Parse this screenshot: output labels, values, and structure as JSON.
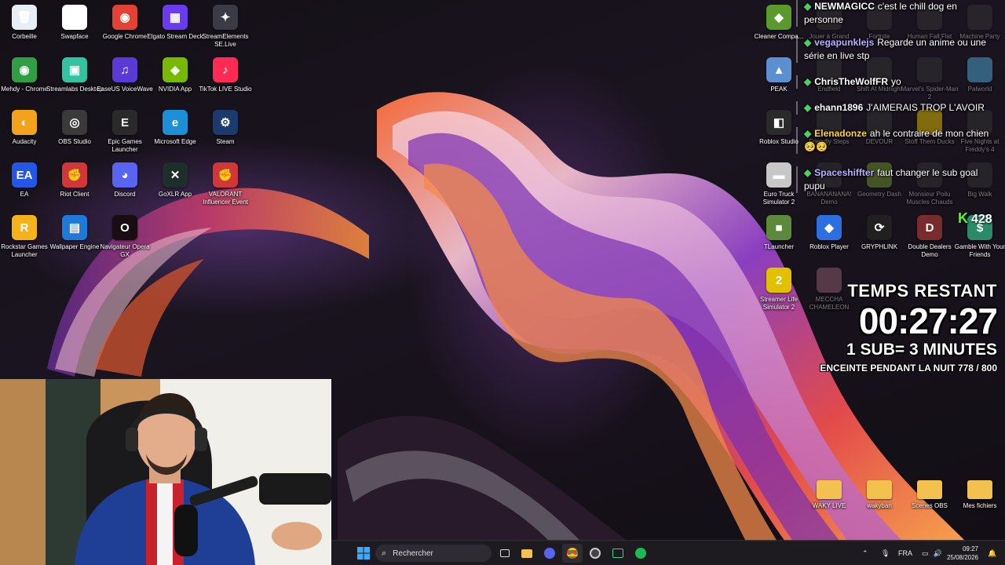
{
  "desktop_left": {
    "icons": [
      {
        "label": "Corbeille",
        "icon": "recycle-bin-icon",
        "glyph": "🗑",
        "color": "#e7eef5"
      },
      {
        "label": "Swapface",
        "icon": "mask-icon",
        "glyph": "◼",
        "color": "#ffffff"
      },
      {
        "label": "Google Chrome",
        "icon": "chrome-icon",
        "glyph": "◉",
        "color": "#e34133"
      },
      {
        "label": "Elgato Stream Deck",
        "icon": "stream-deck-icon",
        "glyph": "▦",
        "color": "#6a3cf0"
      },
      {
        "label": "StreamElements SE.Live",
        "icon": "se-live-icon",
        "glyph": "✦",
        "color": "#3b3b48"
      },
      {
        "label": "Mehdy - Chrome",
        "icon": "chrome-profile-icon",
        "glyph": "◉",
        "color": "#2f9e44"
      },
      {
        "label": "Streamlabs Desktop",
        "icon": "streamlabs-icon",
        "glyph": "▣",
        "color": "#31c3a2"
      },
      {
        "label": "EaseUS VoiceWave",
        "icon": "voicewave-icon",
        "glyph": "♫",
        "color": "#5a3ad6"
      },
      {
        "label": "NVIDIA App",
        "icon": "nvidia-icon",
        "glyph": "◈",
        "color": "#76b900"
      },
      {
        "label": "TikTok LIVE Studio",
        "icon": "tiktok-icon",
        "glyph": "♪",
        "color": "#fe2c55"
      },
      {
        "label": "Audacity",
        "icon": "audacity-icon",
        "glyph": "◐",
        "color": "#f2a21b"
      },
      {
        "label": "OBS Studio",
        "icon": "obs-icon",
        "glyph": "◎",
        "color": "#3a3a3a"
      },
      {
        "label": "Epic Games Launcher",
        "icon": "epic-games-icon",
        "glyph": "E",
        "color": "#2a2a2a"
      },
      {
        "label": "Microsoft Edge",
        "icon": "edge-icon",
        "glyph": "e",
        "color": "#1d8fd6"
      },
      {
        "label": "Steam",
        "icon": "steam-icon",
        "glyph": "⚙",
        "color": "#1b3b6f"
      },
      {
        "label": "EA",
        "icon": "ea-icon",
        "glyph": "EA",
        "color": "#2457e6"
      },
      {
        "label": "Riot Client",
        "icon": "riot-icon",
        "glyph": "✊",
        "color": "#d13639"
      },
      {
        "label": "Discord",
        "icon": "discord-icon",
        "glyph": "◕",
        "color": "#5865f2"
      },
      {
        "label": "GoXLR App",
        "icon": "goxlr-icon",
        "glyph": "✕",
        "color": "#1e2e2b"
      },
      {
        "label": "VALORANT Influencer Event",
        "icon": "valorant-icon",
        "glyph": "✊",
        "color": "#d13639"
      },
      {
        "label": "Rockstar Games Launcher",
        "icon": "rockstar-icon",
        "glyph": "R",
        "color": "#f6b21b"
      },
      {
        "label": "Wallpaper Engine",
        "icon": "wallpaper-engine-icon",
        "glyph": "▤",
        "color": "#1f79d8"
      },
      {
        "label": "Navigateur Opera GX",
        "icon": "opera-gx-icon",
        "glyph": "O",
        "color": "#1a0d12"
      }
    ]
  },
  "desktop_right": {
    "icons": [
      {
        "label": "Cleaner Compa...",
        "icon": "cleaner-icon",
        "glyph": "◆",
        "color": "#5a9a2c",
        "dim": false
      },
      {
        "label": "Jouer à Grand",
        "icon": "gta-icon",
        "glyph": "",
        "color": "#333",
        "dim": true
      },
      {
        "label": "Fortnite",
        "icon": "fortnite-icon",
        "glyph": "",
        "color": "#333",
        "dim": true
      },
      {
        "label": "Human Fall Flat",
        "icon": "human-fall-flat-icon",
        "glyph": "",
        "color": "#333",
        "dim": true
      },
      {
        "label": "Machine Party",
        "icon": "machine-party-icon",
        "glyph": "",
        "color": "#333",
        "dim": true
      },
      {
        "label": "PEAK",
        "icon": "peak-icon",
        "glyph": "▲",
        "color": "#5b8fd0",
        "dim": false
      },
      {
        "label": "Endfield",
        "icon": "endfield-icon",
        "glyph": "",
        "color": "#333",
        "dim": true
      },
      {
        "label": "Shift At Midnight",
        "icon": "shift-at-midnight-icon",
        "glyph": "",
        "color": "#333",
        "dim": true
      },
      {
        "label": "Marvel's Spider-Man 2",
        "icon": "spiderman-icon",
        "glyph": "",
        "color": "#333",
        "dim": true
      },
      {
        "label": "Palworld",
        "icon": "palworld-icon",
        "glyph": "",
        "color": "#4aa0c8",
        "dim": true
      },
      {
        "label": "Roblox Studio",
        "icon": "roblox-studio-icon",
        "glyph": "◧",
        "color": "#2a2a2a",
        "dim": false
      },
      {
        "label": "Friendly Steps",
        "icon": "friendly-steps-icon",
        "glyph": "",
        "color": "#333",
        "dim": true
      },
      {
        "label": "DEVOUR",
        "icon": "devour-icon",
        "glyph": "",
        "color": "#333",
        "dim": true
      },
      {
        "label": "Stoff Them Ducks",
        "icon": "ducks-icon",
        "glyph": "",
        "color": "#d8b400",
        "dim": true
      },
      {
        "label": "Five Nights at Freddy's 4",
        "icon": "fnaf-icon",
        "glyph": "",
        "color": "#333",
        "dim": true
      },
      {
        "label": "Euro Truck Simulator 2",
        "icon": "euro-truck-icon",
        "glyph": "▬",
        "color": "#c7c7c7",
        "dim": false
      },
      {
        "label": "BANANANANA! Demo",
        "icon": "banana-icon",
        "glyph": "",
        "color": "#333",
        "dim": true
      },
      {
        "label": "Geometry Dash",
        "icon": "geometry-dash-icon",
        "glyph": "",
        "color": "#6a8a2a",
        "dim": true
      },
      {
        "label": "Monsieur Poilu Muscles Chauds",
        "icon": "monsieur-poilu-icon",
        "glyph": "",
        "color": "#333",
        "dim": true
      },
      {
        "label": "Big Walk",
        "icon": "big-walk-icon",
        "glyph": "",
        "color": "#333",
        "dim": true
      },
      {
        "label": "TLauncher",
        "icon": "tlauncher-icon",
        "glyph": "■",
        "color": "#5c8a3a",
        "dim": false
      },
      {
        "label": "Roblox Player",
        "icon": "roblox-player-icon",
        "glyph": "◆",
        "color": "#2b6fe0",
        "dim": false
      },
      {
        "label": "GRYPHLINK",
        "icon": "gryphlink-icon",
        "glyph": "⟳",
        "color": "#202020",
        "dim": false
      },
      {
        "label": "Double Dealers Demo",
        "icon": "double-dealers-icon",
        "glyph": "D",
        "color": "#7a2c2c",
        "dim": false
      },
      {
        "label": "Gamble With Your Friends",
        "icon": "gamble-icon",
        "glyph": "$",
        "color": "#2a8a6a",
        "dim": false
      },
      {
        "label": "Streamer Life Simulator 2",
        "icon": "streamer-life-icon",
        "glyph": "2",
        "color": "#e0c000",
        "dim": false
      },
      {
        "label": "MECCHA CHAMELEON",
        "icon": "meccha-chameleon-icon",
        "glyph": "",
        "color": "#8a5a6a",
        "dim": true
      },
      {
        "label": "WAKY LIVE",
        "icon": "folder-icon",
        "glyph": "",
        "color": "#f2c14e",
        "dim": false
      },
      {
        "label": "wakyban",
        "icon": "folder-icon",
        "glyph": "",
        "color": "#f2c14e",
        "dim": false
      },
      {
        "label": "Scenes OBS",
        "icon": "folder-icon",
        "glyph": "",
        "color": "#f2c14e",
        "dim": false
      },
      {
        "label": "Mes fichiers",
        "icon": "folder-icon",
        "glyph": "",
        "color": "#f2c14e",
        "dim": false
      }
    ]
  },
  "chat": {
    "messages": [
      {
        "user": "NEWMAGICC",
        "user_color": "#ffffff",
        "text": "c'est le chill dog en personne"
      },
      {
        "user": "vegapunklejs",
        "user_color": "#b9b1ff",
        "text": "Regarde un anime ou une série en live stp"
      },
      {
        "user": "ChrisTheWolfFR",
        "user_color": "#ffffff",
        "text": "yo"
      },
      {
        "user": "ehann1896",
        "user_color": "#ffffff",
        "text": "J'AIMERAIS TROP L'AVOIR"
      },
      {
        "user": "Elenadonze",
        "user_color": "#ffd23f",
        "text": "ah le contraire de mon chien 🥺🥺"
      },
      {
        "user": "Spaceshiffter",
        "user_color": "#b9b1ff",
        "text": "faut changer le sub goal pupu"
      }
    ]
  },
  "sub_counter": {
    "badge": "K",
    "value": "428"
  },
  "timer": {
    "heading": "TEMPS RESTANT",
    "time": "00:27:27",
    "rule": "1 SUB= 3 MINUTES",
    "goal": "ENCEINTE PENDANT LA NUIT 778 / 800"
  },
  "taskbar": {
    "search_placeholder": "Rechercher",
    "language": "FRA",
    "time": "09:27",
    "date": "25/08/2026"
  },
  "colors": {
    "kick_green": "#53fc18",
    "chat_badge": "#4ecf64"
  }
}
